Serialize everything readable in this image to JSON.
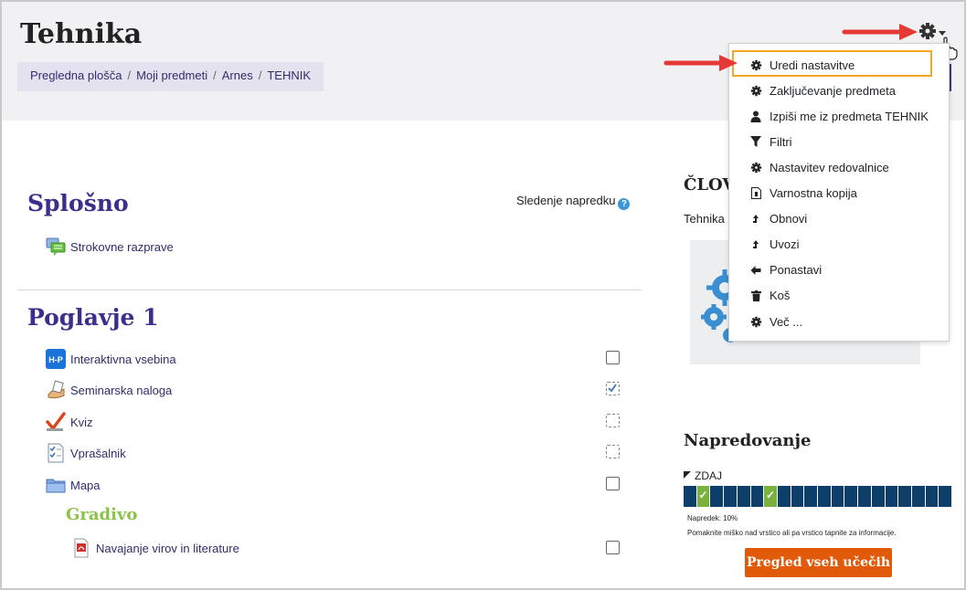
{
  "header": {
    "title": "Tehnika",
    "breadcrumbs": [
      "Pregledna plošča",
      "Moji predmeti",
      "Arnes",
      "TEHNIK"
    ]
  },
  "main": {
    "sections": [
      {
        "title": "Splošno"
      },
      {
        "title": "Poglavje 1"
      }
    ],
    "progress_tracking_label": "Sledenje napredku",
    "general_activities": [
      {
        "label": "Strokovne razprave",
        "icon": "forum-icon"
      }
    ],
    "chapter_activities": [
      {
        "label": "Interaktivna vsebina",
        "icon": "h5p-icon",
        "completion": "unchecked"
      },
      {
        "label": "Seminarska naloga",
        "icon": "assignment-icon",
        "completion": "checked-auto"
      },
      {
        "label": "Kviz",
        "icon": "quiz-icon",
        "completion": "auto-unchecked"
      },
      {
        "label": "Vprašalnik",
        "icon": "questionnaire-icon",
        "completion": "auto-unchecked"
      },
      {
        "label": "Mapa",
        "icon": "folder-icon",
        "completion": "unchecked"
      }
    ],
    "subheading": "Gradivo",
    "material_activities": [
      {
        "label": "Navajanje virov in literature",
        "icon": "pdf-icon",
        "completion": "unchecked"
      }
    ]
  },
  "sidebar": {
    "people_heading": "ČLOV",
    "people_text": "Tehnika",
    "progress_heading": "Napredovanje",
    "now_label": "ZDAJ",
    "progress_text": "Napredek: 10%",
    "progress_value": 0.1,
    "progress_hint": "Pomaknite miško nad vrstico ali pa vrstico tapnite za informacije.",
    "progress_segments": 20,
    "progress_done_segments": [
      1,
      6
    ],
    "all_learners_button": "Pregled vseh učečih"
  },
  "menu": {
    "items": [
      {
        "label": "Uredi nastavitve",
        "icon": "gear-icon"
      },
      {
        "label": "Zaključevanje predmeta",
        "icon": "gear-icon"
      },
      {
        "label": "Izpiši me iz predmeta TEHNIK",
        "icon": "user-icon"
      },
      {
        "label": "Filtri",
        "icon": "filter-icon"
      },
      {
        "label": "Nastavitev redovalnice",
        "icon": "gear-icon"
      },
      {
        "label": "Varnostna kopija",
        "icon": "backup-file-icon"
      },
      {
        "label": "Obnovi",
        "icon": "restore-icon"
      },
      {
        "label": "Uvozi",
        "icon": "import-icon"
      },
      {
        "label": "Ponastavi",
        "icon": "arrow-left-icon"
      },
      {
        "label": "Koš",
        "icon": "trash-icon"
      },
      {
        "label": "Več ...",
        "icon": "gear-icon"
      }
    ]
  },
  "colors": {
    "accent": "#3b2f8c",
    "annotation_arrow": "#e53935",
    "highlight_border": "#f5a623",
    "progress_done": "#7ab23d",
    "progress_todo": "#0e3f6b",
    "button": "#e15a0a"
  }
}
